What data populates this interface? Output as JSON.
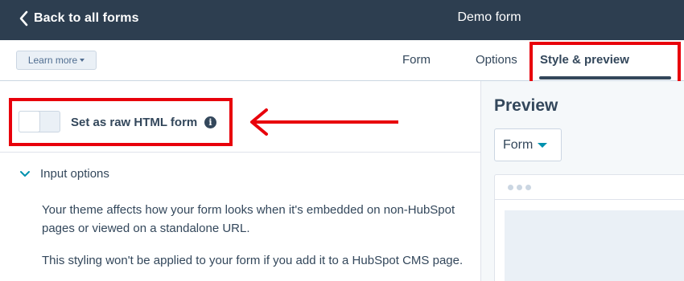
{
  "header": {
    "back_label": "Back to all forms",
    "title": "Demo form"
  },
  "subheader": {
    "learn_more_label": "Learn more",
    "tabs": [
      {
        "label": "Form",
        "active": false
      },
      {
        "label": "Options",
        "active": false
      },
      {
        "label": "Style & preview",
        "active": true
      }
    ]
  },
  "settings": {
    "raw_html_toggle": {
      "label": "Set as raw HTML form",
      "checked": false
    },
    "section_title": "Input options",
    "paragraphs": [
      "Your theme affects how your form looks when it's embedded on non-HubSpot pages or viewed on a standalone URL.",
      "This styling won't be applied to your form if you add it to a HubSpot CMS page."
    ]
  },
  "preview": {
    "title": "Preview",
    "dropdown_value": "Form"
  },
  "colors": {
    "header_bg": "#2d3e50",
    "highlight": "#e8000b",
    "text": "#33475b",
    "accent": "#0091ae"
  },
  "icons": {
    "back": "chevron-left-icon",
    "info": "info-icon",
    "collapse": "chevron-down-icon",
    "annotation": "arrow-left-icon"
  }
}
